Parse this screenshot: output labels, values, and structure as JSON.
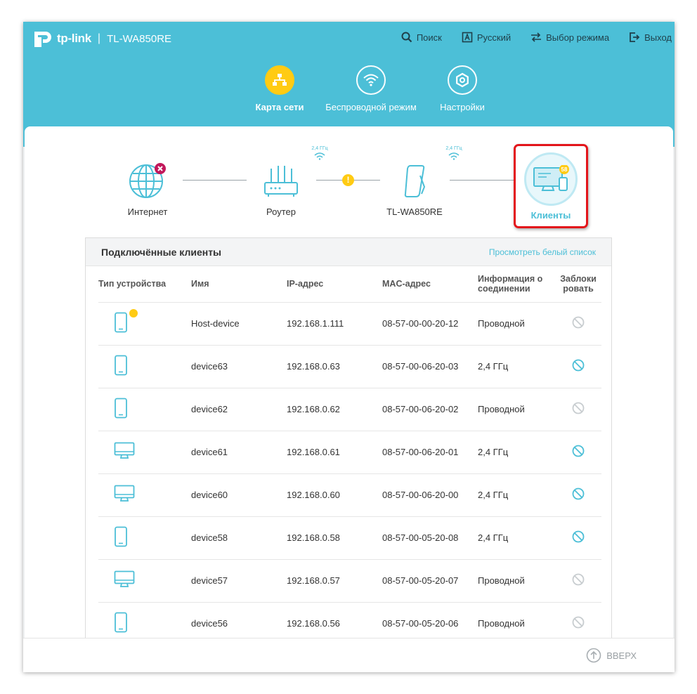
{
  "header": {
    "brand": "tp-link",
    "model": "TL-WA850RE",
    "nav": {
      "search": "Поиск",
      "language": "Русский",
      "mode": "Выбор режима",
      "logout": "Выход"
    },
    "tabs": [
      {
        "label": "Карта сети",
        "active": true
      },
      {
        "label": "Беспроводной режим",
        "active": false
      },
      {
        "label": "Настройки",
        "active": false
      }
    ]
  },
  "netmap": {
    "internet_label": "Интернет",
    "router_label": "Роутер",
    "extender_label": "TL-WA850RE",
    "clients_label": "Клиенты",
    "band_1": "2,4 ГГц",
    "band_2": "2,4 ГГц",
    "clients_count": "58",
    "internet_status": "disconnected",
    "router_link_status": "warning"
  },
  "clients_table": {
    "title": "Подключённые клиенты",
    "whitelist_link": "Просмотреть белый список",
    "headers": {
      "type": "Тип устройства",
      "name": "Имя",
      "ip": "IP-адрес",
      "mac": "MAC-адрес",
      "connection": "Информация о соединении",
      "block": "Заблокировать"
    },
    "rows": [
      {
        "type": "phone",
        "name": "Host-device",
        "ip": "192.168.1.111",
        "mac": "08-57-00-00-20-12",
        "connection": "Проводной",
        "host": true,
        "block_enabled": false
      },
      {
        "type": "phone",
        "name": "device63",
        "ip": "192.168.0.63",
        "mac": "08-57-00-06-20-03",
        "connection": "2,4 ГГц",
        "host": false,
        "block_enabled": true
      },
      {
        "type": "phone",
        "name": "device62",
        "ip": "192.168.0.62",
        "mac": "08-57-00-06-20-02",
        "connection": "Проводной",
        "host": false,
        "block_enabled": false
      },
      {
        "type": "monitor",
        "name": "device61",
        "ip": "192.168.0.61",
        "mac": "08-57-00-06-20-01",
        "connection": "2,4 ГГц",
        "host": false,
        "block_enabled": true
      },
      {
        "type": "monitor",
        "name": "device60",
        "ip": "192.168.0.60",
        "mac": "08-57-00-06-20-00",
        "connection": "2,4 ГГц",
        "host": false,
        "block_enabled": true
      },
      {
        "type": "phone",
        "name": "device58",
        "ip": "192.168.0.58",
        "mac": "08-57-00-05-20-08",
        "connection": "2,4 ГГц",
        "host": false,
        "block_enabled": true
      },
      {
        "type": "monitor",
        "name": "device57",
        "ip": "192.168.0.57",
        "mac": "08-57-00-05-20-07",
        "connection": "Проводной",
        "host": false,
        "block_enabled": false
      },
      {
        "type": "phone",
        "name": "device56",
        "ip": "192.168.0.56",
        "mac": "08-57-00-05-20-06",
        "connection": "Проводной",
        "host": false,
        "block_enabled": false
      }
    ]
  },
  "footer": {
    "up_label": "ВВЕРХ"
  },
  "colors": {
    "accent": "#4cbfd7",
    "highlight": "#ffcb13",
    "annotation_red": "#e3151b"
  }
}
